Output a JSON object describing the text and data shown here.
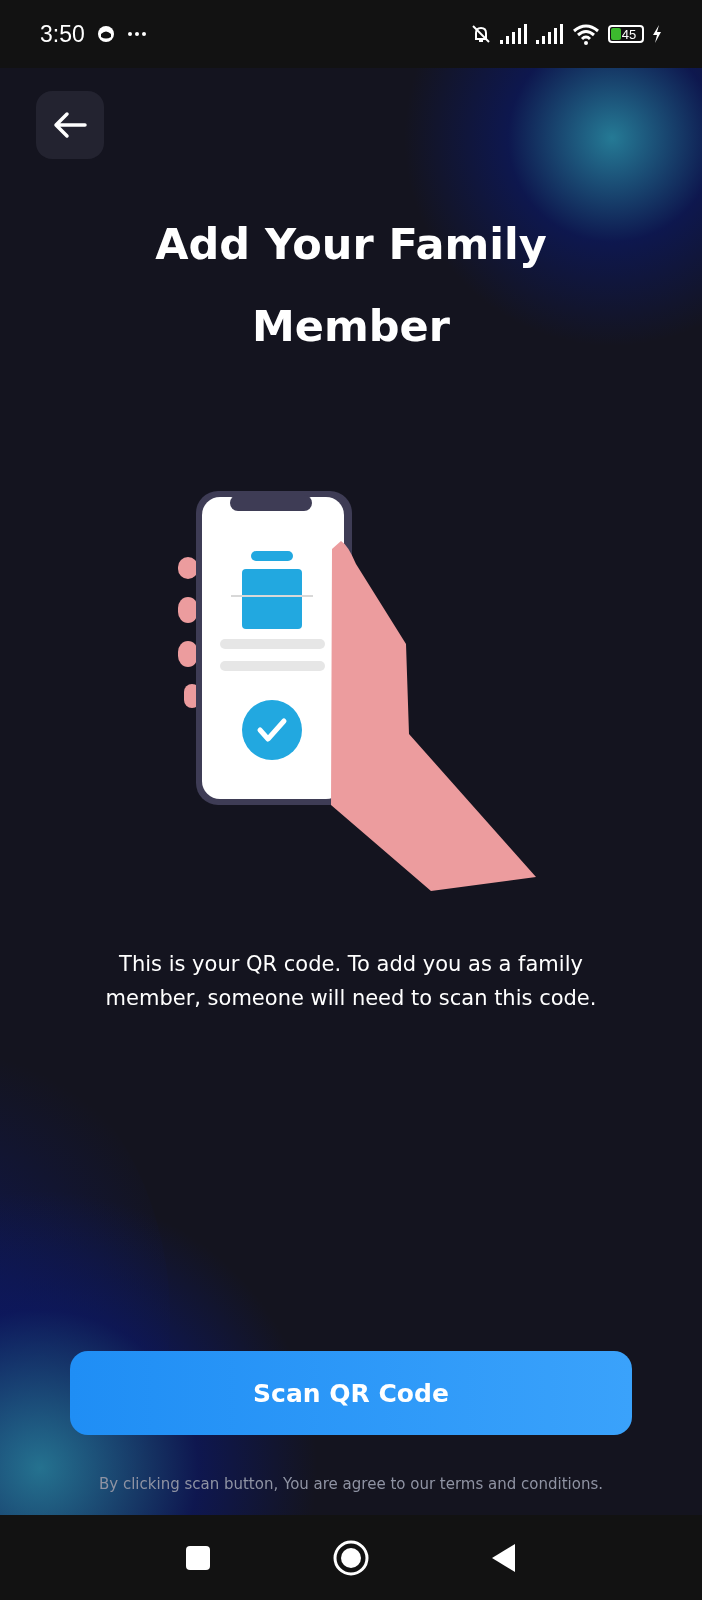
{
  "status_bar": {
    "time": "3:50",
    "battery": "45"
  },
  "title": "Add Your Family Member",
  "description": "This is your QR code. To add you as a family member, someone will need to scan this code.",
  "primary_button": "Scan QR Code",
  "footer_note": "By clicking scan button, You are agree to our terms and conditions."
}
